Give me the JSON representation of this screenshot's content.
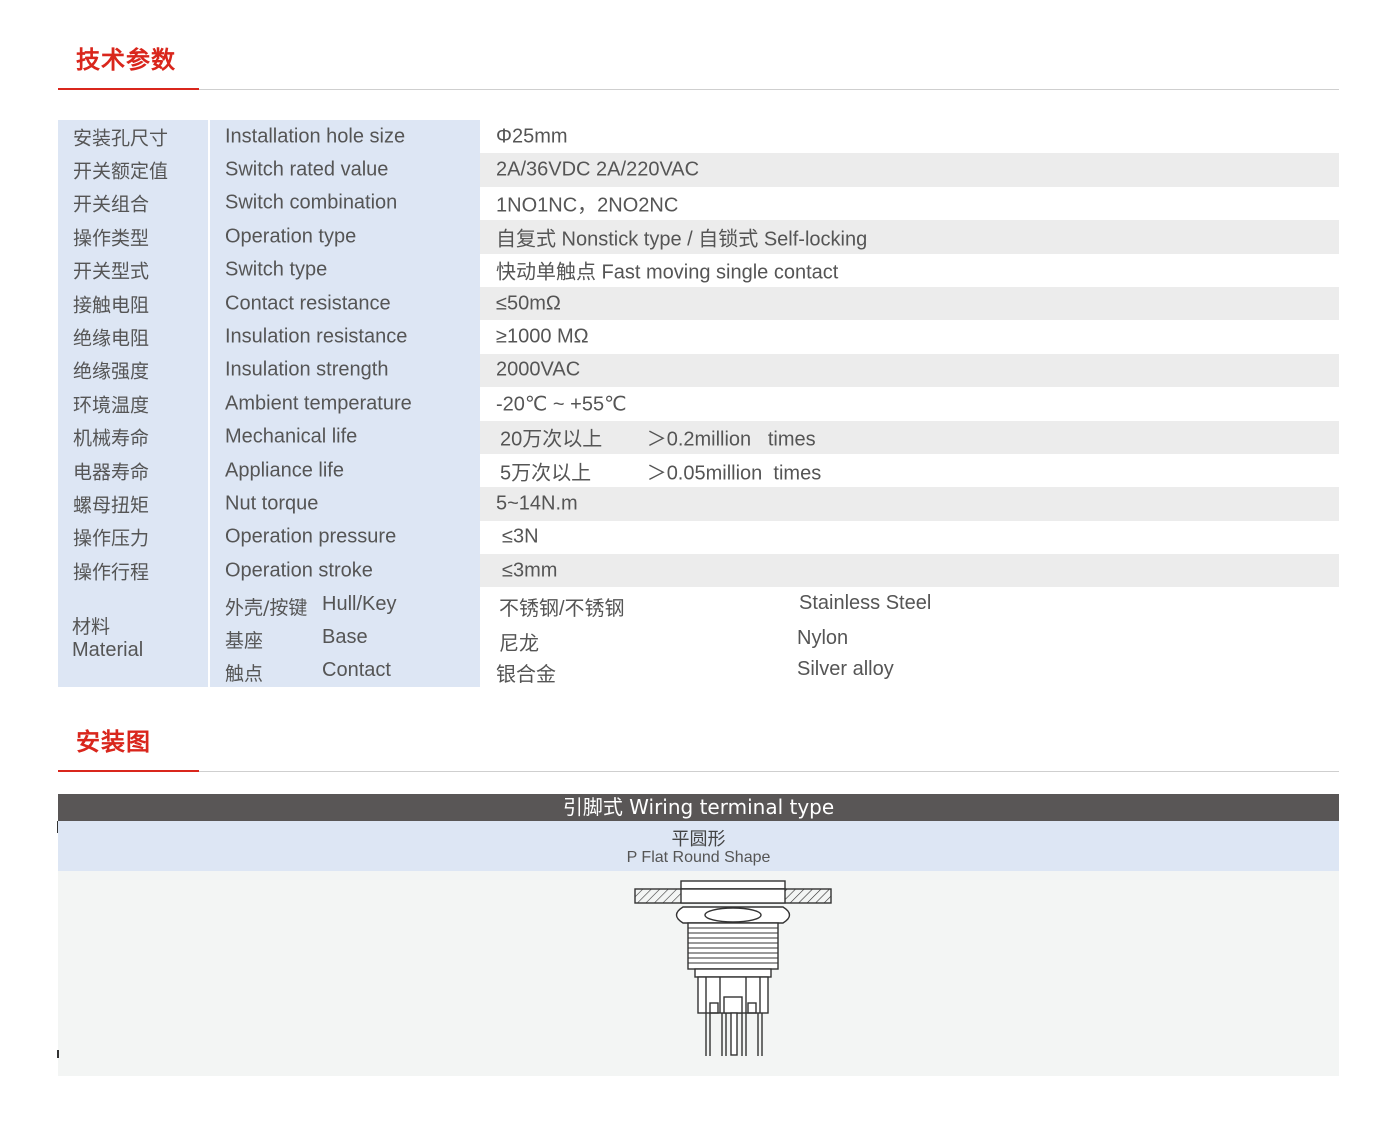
{
  "sections": {
    "params_title": "技术参数",
    "install_title": "安装图"
  },
  "specs": [
    {
      "cn": "安装孔尺寸",
      "en": "Installation hole size",
      "value": "Φ25mm"
    },
    {
      "cn": "开关额定值",
      "en": "Switch rated value",
      "value": "2A/36VDC  2A/220VAC"
    },
    {
      "cn": "开关组合",
      "en": "Switch combination",
      "value": "1NO1NC，2NO2NC"
    },
    {
      "cn": "操作类型",
      "en": "Operation type",
      "value": "自复式 Nonstick type / 自锁式 Self-locking"
    },
    {
      "cn": "开关型式",
      "en": "Switch type",
      "value": "快动单触点  Fast moving single contact"
    },
    {
      "cn": "接触电阻",
      "en": "Contact resistance",
      "value": "≤50mΩ"
    },
    {
      "cn": "绝缘电阻",
      "en": "Insulation resistance",
      "value": "≥1000 MΩ"
    },
    {
      "cn": "绝缘强度",
      "en": "Insulation strength",
      "value": "2000VAC"
    },
    {
      "cn": "环境温度",
      "en": "Ambient temperature",
      "value": "-20℃ ~ +55℃"
    },
    {
      "cn": "机械寿命",
      "en": "Mechanical life",
      "value": "20万次以上        ＞0.2million   times"
    },
    {
      "cn": "电器寿命",
      "en": "Appliance life",
      "value": "5万次以上          ＞0.05million  times"
    },
    {
      "cn": "螺母扭矩",
      "en": "Nut torque",
      "value": "5~14N.m"
    },
    {
      "cn": "操作压力",
      "en": "Operation pressure",
      "value": "≤3N"
    },
    {
      "cn": "操作行程",
      "en": "Operation stroke",
      "value": "≤3mm"
    }
  ],
  "material": {
    "cn": "材料",
    "en": "Material",
    "items": [
      {
        "part_cn": "外壳/按键",
        "part_en": "Hull/Key",
        "value_cn": "不锈钢/不锈钢",
        "value_en": "Stainless Steel"
      },
      {
        "part_cn": "基座",
        "part_en": "Base",
        "value_cn": "尼龙",
        "value_en": "Nylon"
      },
      {
        "part_cn": "触点",
        "part_en": "Contact",
        "value_cn": "银合金",
        "value_en": "Silver alloy"
      }
    ]
  },
  "install": {
    "banner": "引脚式 Wiring terminal type",
    "shape_cn": "平圆形",
    "shape_en": "P Flat Round Shape"
  },
  "colors": {
    "accent": "#d9261c",
    "label_bg": "#dde6f4",
    "alt_row_bg": "#ececec",
    "banner_bg": "#595656"
  }
}
